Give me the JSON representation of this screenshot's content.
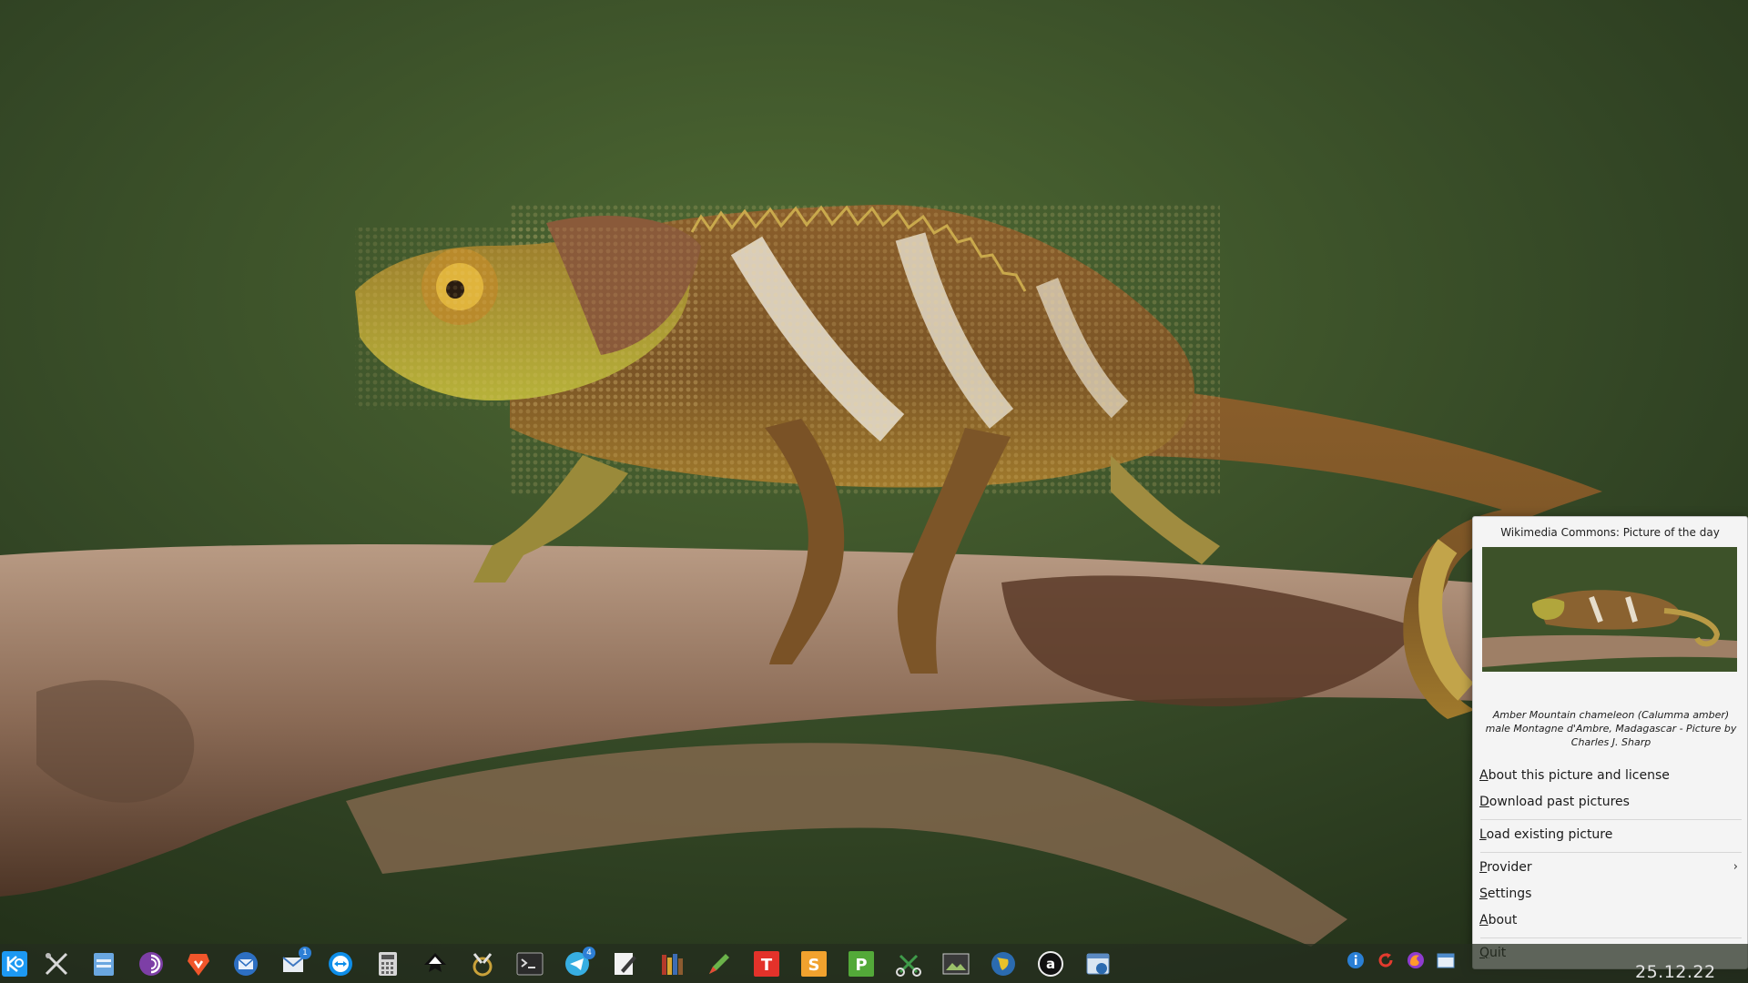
{
  "popup": {
    "title": "Wikimedia Commons: Picture of the day",
    "caption": "Amber Mountain chameleon (Calumma amber) male Montagne d'Ambre, Madagascar - Picture by Charles J. Sharp",
    "menu": {
      "about_picture": {
        "mnemonic": "A",
        "rest": "bout this picture and license"
      },
      "download_past": {
        "mnemonic": "D",
        "rest": "ownload past pictures"
      },
      "load_existing": {
        "mnemonic": "L",
        "rest": "oad existing picture"
      },
      "provider": {
        "mnemonic": "P",
        "rest": "rovider",
        "arrow": "›"
      },
      "settings": {
        "mnemonic": "S",
        "rest": "ettings"
      },
      "about": {
        "mnemonic": "A",
        "rest": "bout"
      },
      "quit": {
        "mnemonic": "Q",
        "rest": "uit"
      }
    }
  },
  "taskbar": {
    "launchers": [
      {
        "icon": "kde-launcher-icon"
      },
      {
        "icon": "system-tools-icon"
      },
      {
        "icon": "file-manager-icon"
      },
      {
        "icon": "tor-browser-icon"
      },
      {
        "icon": "brave-browser-icon"
      },
      {
        "icon": "mail-client-icon"
      },
      {
        "icon": "mail-notifier-icon",
        "badge": "1"
      },
      {
        "icon": "teamviewer-icon"
      },
      {
        "icon": "calculator-icon"
      },
      {
        "icon": "inkscape-icon"
      },
      {
        "icon": "plugin-tool-icon"
      },
      {
        "icon": "terminal-icon"
      },
      {
        "icon": "telegram-icon",
        "badge": "4"
      },
      {
        "icon": "text-editor-icon"
      },
      {
        "icon": "library-icon"
      },
      {
        "icon": "pencil-icon"
      },
      {
        "icon": "office-writer-icon",
        "letter": "T"
      },
      {
        "icon": "office-spreadsheet-icon",
        "letter": "S"
      },
      {
        "icon": "office-presentation-icon",
        "letter": "P"
      },
      {
        "icon": "scissors-icon"
      },
      {
        "icon": "image-viewer-icon"
      },
      {
        "icon": "globe-icon"
      },
      {
        "icon": "amazon-icon",
        "letter": "a"
      },
      {
        "icon": "picture-of-day-icon"
      }
    ],
    "tray": [
      {
        "icon": "info-icon"
      },
      {
        "icon": "update-icon"
      },
      {
        "icon": "firefox-icon"
      },
      {
        "icon": "calendar-icon"
      }
    ],
    "clock": "25.12.22"
  },
  "colors": {
    "popup_bg": "#f4f4f4",
    "taskbar_bg": "#242c1e",
    "writer_red": "#e3322a",
    "spreadsheet_orange": "#f1a22e",
    "presentation_green": "#53a939",
    "badge_blue": "#2d7fd6"
  }
}
